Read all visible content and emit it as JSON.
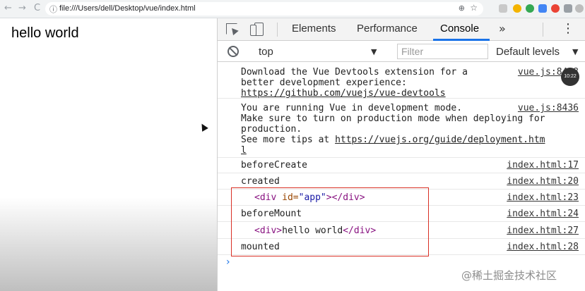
{
  "browser": {
    "back": "←",
    "forward": "→",
    "reload": "C",
    "address": "file:///Users/dell/Desktop/vue/index.html",
    "info_icon": "ⓘ",
    "zoom_icon": "⊕",
    "star_icon": "☆"
  },
  "page": {
    "text": "hello world"
  },
  "devtools": {
    "tabs": [
      "Elements",
      "Performance",
      "Console"
    ],
    "more_tabs": "»",
    "menu": "⋮",
    "context": "top",
    "caret": "▼",
    "filter_placeholder": "Filter",
    "levels": "Default levels",
    "prompt": "›",
    "badge": "10:22"
  },
  "console": {
    "m1": {
      "line1": "Download the Vue Devtools extension for a",
      "line2": "better development experience:",
      "link": "https://github.com/vuejs/vue-devtools",
      "src": "vue.js:8428"
    },
    "m2": {
      "line1": "You are running Vue in development mode.",
      "line2": "Make sure to turn on production mode when deploying for",
      "line3": "production.",
      "line4_pre": "See more tips at ",
      "link_a": "https://vuejs.org/guide/deployment.htm",
      "link_b": "l",
      "src": "vue.js:8436"
    },
    "m3": {
      "text": "beforeCreate",
      "src": "index.html:17"
    },
    "m4": {
      "text": "created",
      "src": "index.html:20"
    },
    "m5": {
      "open": "<div",
      "attr": " id=",
      "val": "\"app\"",
      "close": "></div>",
      "src": "index.html:23"
    },
    "m6": {
      "text": "beforeMount",
      "src": "index.html:24"
    },
    "m7": {
      "open": "<div>",
      "text": "hello world",
      "close": "</div>",
      "src": "index.html:27"
    },
    "m8": {
      "text": "mounted",
      "src": "index.html:28"
    }
  },
  "watermark": "@稀土掘金技术社区",
  "colors": {
    "accent": "#1a73e8",
    "highlight_box": "#d93025",
    "tag": "#881280",
    "attr": "#994500",
    "attr_value": "#1a1aa6"
  }
}
